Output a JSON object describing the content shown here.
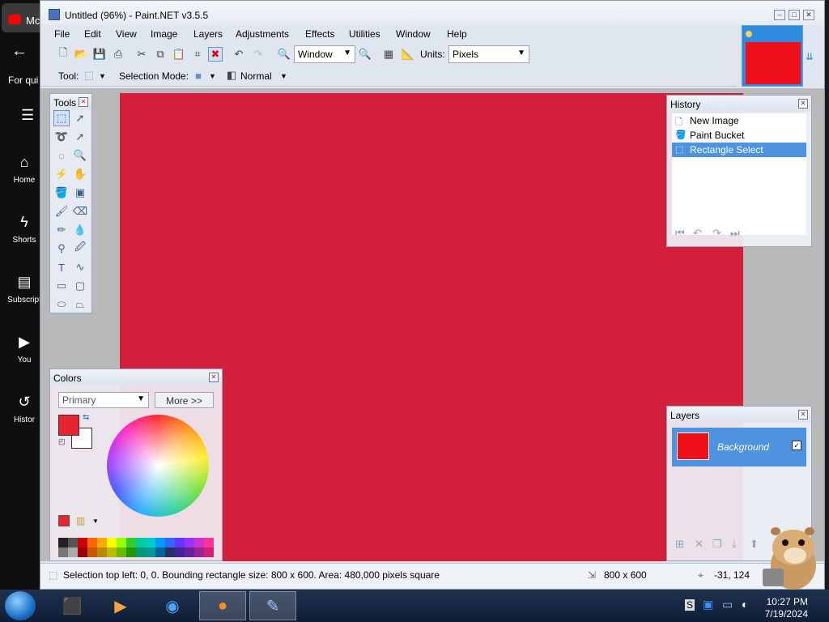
{
  "background": {
    "tab_text": "Mc",
    "for_text": "For qui",
    "nav": [
      {
        "label": "Home",
        "icon": "home-icon"
      },
      {
        "label": "Shorts",
        "icon": "shorts-icon"
      },
      {
        "label": "Subscript",
        "icon": "subscriptions-icon"
      },
      {
        "label": "You",
        "icon": "you-icon"
      },
      {
        "label": "Histor",
        "icon": "history-icon"
      }
    ]
  },
  "window": {
    "title": "Untitled (96%) - Paint.NET v3.5.5"
  },
  "menu": [
    "File",
    "Edit",
    "View",
    "Image",
    "Layers",
    "Adjustments",
    "Effects",
    "Utilities",
    "Window",
    "Help"
  ],
  "toolbar": {
    "zoom_value": "Window",
    "units_label": "Units:",
    "units_value": "Pixels"
  },
  "toolbar2": {
    "tool_label": "Tool:",
    "selection_mode_label": "Selection Mode:",
    "blend_value": "Normal"
  },
  "tools_panel": {
    "title": "Tools"
  },
  "history_panel": {
    "title": "History",
    "items": [
      "New Image",
      "Paint Bucket",
      "Rectangle Select"
    ],
    "selected_index": 2
  },
  "colors_panel": {
    "title": "Colors",
    "mode_value": "Primary",
    "more_label": "More >>",
    "primary_color": "#e8252e",
    "secondary_color": "#ffffff"
  },
  "layers_panel": {
    "title": "Layers",
    "layers": [
      {
        "name": "Background",
        "visible": true
      }
    ]
  },
  "canvas": {
    "fill_color": "#d41f3c"
  },
  "status": {
    "selection_text": "Selection top left: 0, 0. Bounding rectangle size: 800 x 600. Area: 480,000 pixels square",
    "image_size": "800 x 600",
    "cursor_pos": "-31, 124"
  },
  "taskbar": {
    "time": "10:27 PM",
    "date": "7/19/2024",
    "tray_label": "S"
  }
}
